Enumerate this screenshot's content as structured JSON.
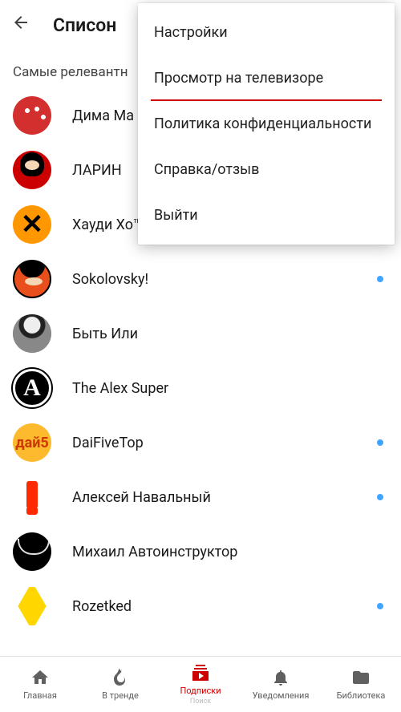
{
  "header": {
    "title": "Списон"
  },
  "section_header": "Самые релевантн",
  "channels": [
    {
      "name": "Дима Ма",
      "has_new": false,
      "avatar_key": "runners"
    },
    {
      "name": "ЛАРИН",
      "has_new": false,
      "avatar_key": "larin"
    },
    {
      "name": "Хауди Хо™ - Просто о мире IT!",
      "has_new": true,
      "avatar_key": "hx",
      "glyph": "✕"
    },
    {
      "name": "Sokolovsky!",
      "has_new": true,
      "avatar_key": "sok"
    },
    {
      "name": "Быть Или",
      "has_new": false,
      "avatar_key": "byt"
    },
    {
      "name": "The Alex Super",
      "has_new": false,
      "avatar_key": "alex",
      "glyph": "A"
    },
    {
      "name": "DaiFiveTop",
      "has_new": true,
      "avatar_key": "daifive",
      "glyph": "дай5"
    },
    {
      "name": "Алексей Навальный",
      "has_new": true,
      "avatar_key": "naval"
    },
    {
      "name": "Михаил Автоинструктор",
      "has_new": false,
      "avatar_key": "mik"
    },
    {
      "name": "Rozetked",
      "has_new": true,
      "avatar_key": "roz"
    }
  ],
  "menu": {
    "items": [
      "Настройки",
      "Просмотр на телевизоре",
      "Политика конфиденциальности",
      "Справка/отзыв",
      "Выйти"
    ],
    "active_index": 1
  },
  "nav": {
    "items": [
      {
        "label": "Главная",
        "icon": "home"
      },
      {
        "label": "В тренде",
        "icon": "fire"
      },
      {
        "label": "Подписки",
        "icon": "subscriptions",
        "sublabel": "Поиск"
      },
      {
        "label": "Уведомления",
        "icon": "bell"
      },
      {
        "label": "Библиотека",
        "icon": "folder"
      }
    ],
    "active_index": 2
  }
}
